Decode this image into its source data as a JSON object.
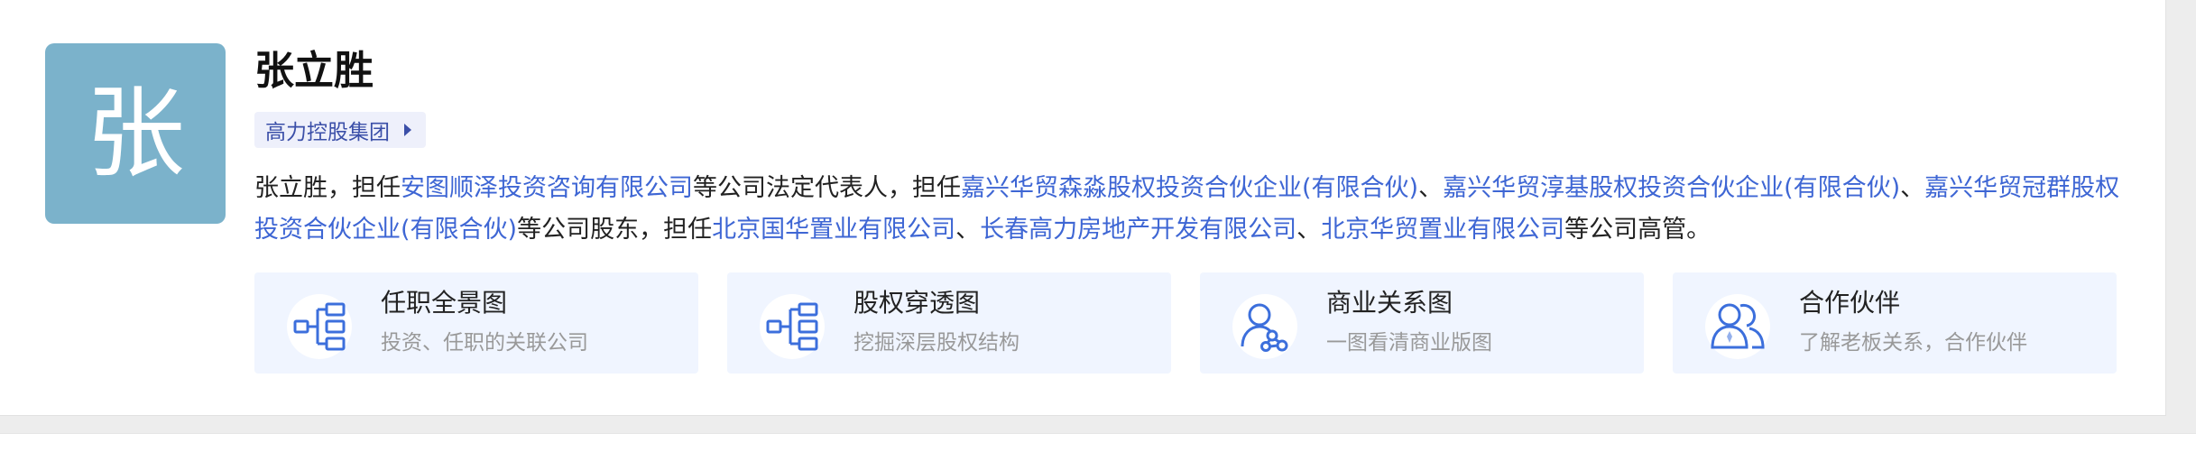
{
  "profile": {
    "avatar_char": "张",
    "name": "张立胜",
    "group_tag": "高力控股集团"
  },
  "description": {
    "p1": "张立胜，担任",
    "l1": "安图顺泽投资咨询有限公司",
    "p2": "等公司法定代表人，担任",
    "l2": "嘉兴华贸森淼股权投资合伙企业(有限合伙)",
    "s1": "、",
    "l3": "嘉兴华贸淳基股权投资合伙企业(有限合伙)",
    "s2": "、",
    "l4": "嘉兴华贸冠群股权投资合伙企业(有限合伙)",
    "p3": "等公司股东，担任",
    "l5": "北京国华置业有限公司",
    "s3": "、",
    "l6": "长春高力房地产开发有限公司",
    "s4": "、",
    "l7": "北京华贸置业有限公司",
    "p4": "等公司高管。"
  },
  "features": [
    {
      "title": "任职全景图",
      "subtitle": "投资、任职的关联公司",
      "icon": "tree-structure-icon"
    },
    {
      "title": "股权穿透图",
      "subtitle": "挖掘深层股权结构",
      "icon": "tree-structure-icon"
    },
    {
      "title": "商业关系图",
      "subtitle": "一图看清商业版图",
      "icon": "person-network-icon"
    },
    {
      "title": "合作伙伴",
      "subtitle": "了解老板关系，合作伙伴",
      "icon": "two-persons-icon"
    }
  ],
  "colors": {
    "avatar_bg": "#7bb2cb",
    "link": "#3e66d4",
    "feature_bg": "#f0f5ff",
    "tag_bg": "#eef0fb",
    "icon_blue": "#3c6fdc"
  }
}
